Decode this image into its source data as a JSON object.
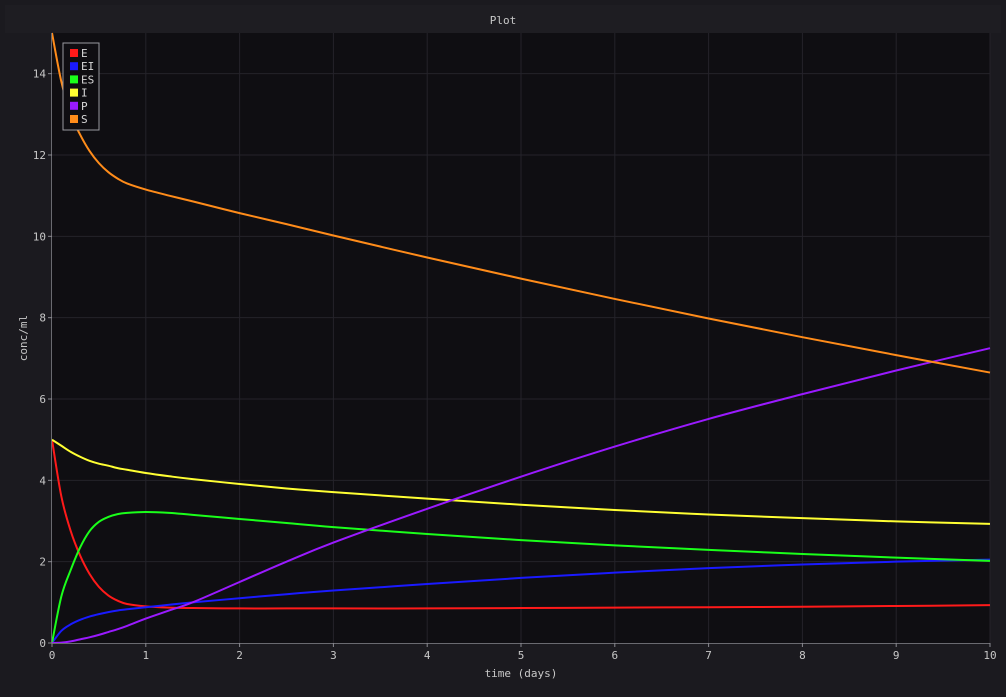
{
  "window": {
    "title": "Plot"
  },
  "chart_data": {
    "type": "line",
    "title": "",
    "xlabel": "time (days)",
    "ylabel": "conc/ml",
    "xlim": [
      0,
      10
    ],
    "ylim": [
      0,
      15
    ],
    "xticks": [
      0,
      1,
      2,
      3,
      4,
      5,
      6,
      7,
      8,
      9,
      10
    ],
    "yticks": [
      0,
      2,
      4,
      6,
      8,
      10,
      12,
      14
    ],
    "grid": true,
    "legend_position": "top-left",
    "x": [
      0,
      0.1,
      0.2,
      0.3,
      0.4,
      0.5,
      0.6,
      0.7,
      0.8,
      1,
      1.25,
      1.5,
      2,
      2.5,
      3,
      4,
      5,
      6,
      7,
      8,
      9,
      10
    ],
    "series": [
      {
        "name": "E",
        "color": "#ff1a1a",
        "values": [
          5.0,
          3.6,
          2.75,
          2.15,
          1.7,
          1.38,
          1.17,
          1.04,
          0.96,
          0.9,
          0.87,
          0.86,
          0.85,
          0.85,
          0.85,
          0.85,
          0.86,
          0.87,
          0.88,
          0.89,
          0.91,
          0.93
        ]
      },
      {
        "name": "EI",
        "color": "#1a1aff",
        "values": [
          0.0,
          0.3,
          0.46,
          0.57,
          0.65,
          0.71,
          0.76,
          0.8,
          0.83,
          0.88,
          0.94,
          1.0,
          1.1,
          1.2,
          1.29,
          1.45,
          1.6,
          1.73,
          1.84,
          1.93,
          2.0,
          2.05
        ]
      },
      {
        "name": "ES",
        "color": "#1aff1a",
        "values": [
          0.0,
          1.15,
          1.8,
          2.35,
          2.75,
          2.98,
          3.1,
          3.17,
          3.2,
          3.22,
          3.2,
          3.15,
          3.05,
          2.95,
          2.85,
          2.68,
          2.53,
          2.4,
          2.29,
          2.19,
          2.1,
          2.02
        ]
      },
      {
        "name": "I",
        "color": "#ffff33",
        "values": [
          5.0,
          4.85,
          4.7,
          4.58,
          4.48,
          4.41,
          4.36,
          4.3,
          4.26,
          4.18,
          4.1,
          4.03,
          3.91,
          3.8,
          3.71,
          3.55,
          3.4,
          3.27,
          3.16,
          3.07,
          2.99,
          2.93
        ]
      },
      {
        "name": "P",
        "color": "#9a1aff",
        "values": [
          0.0,
          0.01,
          0.04,
          0.09,
          0.14,
          0.2,
          0.27,
          0.34,
          0.42,
          0.6,
          0.8,
          1.0,
          1.5,
          2.0,
          2.47,
          3.3,
          4.09,
          4.83,
          5.51,
          6.12,
          6.7,
          7.25
        ]
      },
      {
        "name": "S",
        "color": "#ff8c1a",
        "values": [
          15.0,
          13.8,
          13.0,
          12.5,
          12.1,
          11.8,
          11.58,
          11.42,
          11.3,
          11.15,
          11.0,
          10.86,
          10.57,
          10.3,
          10.02,
          9.48,
          8.96,
          8.46,
          7.98,
          7.52,
          7.08,
          6.65
        ]
      }
    ]
  }
}
